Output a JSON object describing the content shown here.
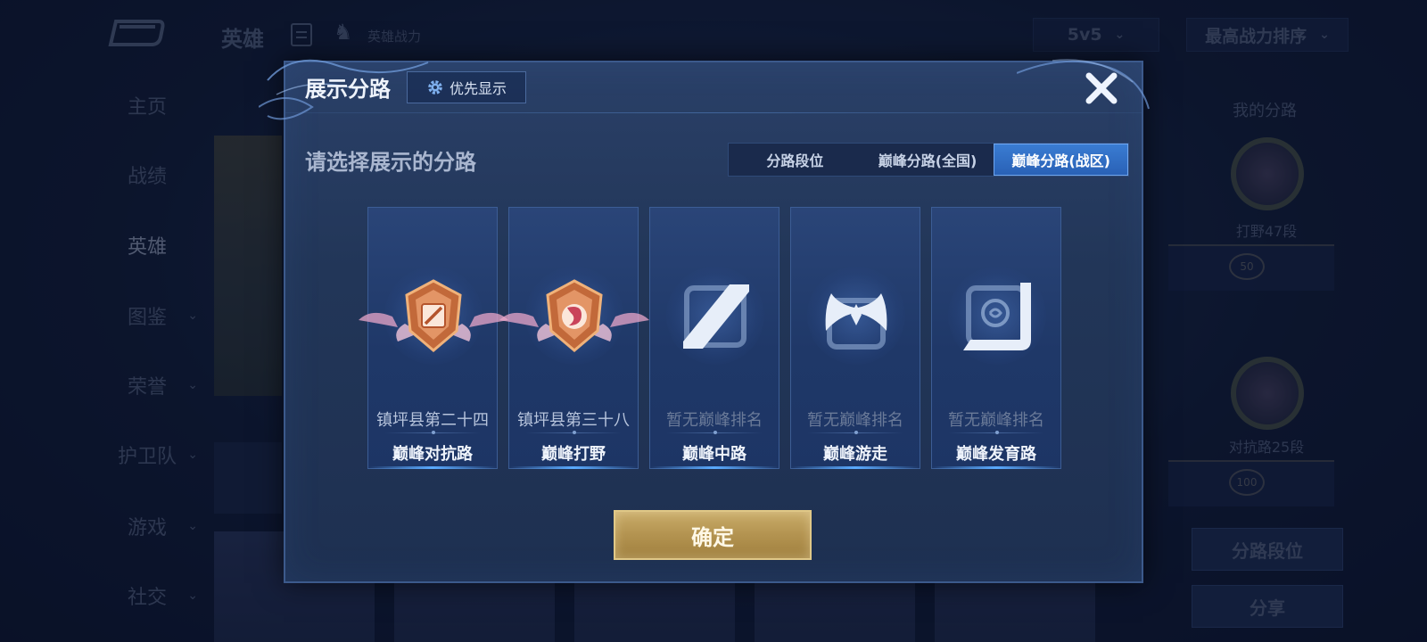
{
  "background": {
    "title": "英雄",
    "power_label": "英雄战力",
    "mode_dropdown": "5v5",
    "sort_dropdown": "最高战力排序",
    "nav": [
      {
        "label": "主页",
        "has_chevron": false
      },
      {
        "label": "战绩",
        "has_chevron": false
      },
      {
        "label": "英雄",
        "has_chevron": false,
        "active": true
      },
      {
        "label": "图鉴",
        "has_chevron": true
      },
      {
        "label": "荣誉",
        "has_chevron": true
      },
      {
        "label": "护卫队",
        "has_chevron": true
      },
      {
        "label": "游戏",
        "has_chevron": true
      },
      {
        "label": "社交",
        "has_chevron": true
      }
    ],
    "right_panel": {
      "title": "我的分路",
      "lane1_label": "打野47段",
      "lane1_num": "50",
      "lane2_label": "对抗路25段",
      "lane2_num": "100",
      "button1": "分路段位",
      "button2": "分享"
    }
  },
  "dialog": {
    "title": "展示分路",
    "priority_button": "优先显示",
    "prompt": "请选择展示的分路",
    "tabs": [
      {
        "label": "分路段位",
        "active": false
      },
      {
        "label": "巅峰分路(全国)",
        "active": false
      },
      {
        "label": "巅峰分路(战区)",
        "active": true
      }
    ],
    "lanes": [
      {
        "rank": "镇坪县第二十四",
        "name": "巅峰对抗路",
        "icon": "clash-lane-medal-icon",
        "ranked": true
      },
      {
        "rank": "镇坪县第三十八",
        "name": "巅峰打野",
        "icon": "jungle-medal-icon",
        "ranked": true
      },
      {
        "rank": "暂无巅峰排名",
        "name": "巅峰中路",
        "icon": "mid-lane-icon",
        "ranked": false
      },
      {
        "rank": "暂无巅峰排名",
        "name": "巅峰游走",
        "icon": "roam-wings-icon",
        "ranked": false
      },
      {
        "rank": "暂无巅峰排名",
        "name": "巅峰发育路",
        "icon": "farm-lane-icon",
        "ranked": false
      }
    ],
    "confirm_button": "确定"
  },
  "colors": {
    "dialog_bg": "#223658",
    "tab_active": "#2961b6",
    "confirm_gold": "#b39350",
    "medal_orange": "#d9834a"
  }
}
